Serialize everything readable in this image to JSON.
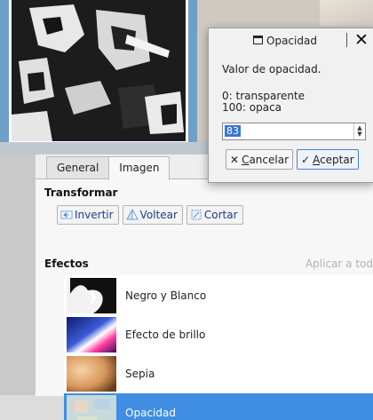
{
  "tabs": [
    {
      "label": "General",
      "active": false
    },
    {
      "label": "Imagen",
      "active": true
    }
  ],
  "transform": {
    "title": "Transformar",
    "buttons": [
      {
        "label": "Invertir",
        "icon": "invert-icon"
      },
      {
        "label": "Voltear",
        "icon": "flip-icon"
      },
      {
        "label": "Cortar",
        "icon": "crop-icon"
      }
    ]
  },
  "effects": {
    "title": "Efectos",
    "apply_all": "Aplicar a tod",
    "items": [
      {
        "label": "Negro y Blanco",
        "selected": false
      },
      {
        "label": "Efecto de brillo",
        "selected": false
      },
      {
        "label": "Sepia",
        "selected": false
      },
      {
        "label": "Opacidad",
        "selected": true
      }
    ]
  },
  "dialog": {
    "title": "Opacidad",
    "prompt": "Valor de opacidad.",
    "hint_line1": "0: transparente",
    "hint_line2": "100: opaca",
    "value": "83",
    "cancel_label": "ancelar",
    "cancel_mnemonic": "C",
    "ok_label": "ceptar",
    "ok_mnemonic": "A"
  },
  "colors": {
    "selection": "#3f8ee3",
    "frame": "#6d9fc8",
    "link_text": "#1b3f8a"
  }
}
